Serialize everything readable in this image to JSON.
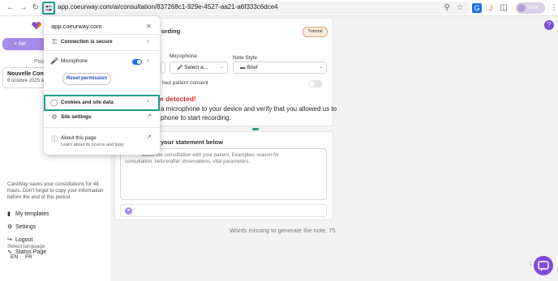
{
  "browser": {
    "url": "app.coeurway.com/ai/consultation/837268c1-929e-4527-aa21-a6f333c6dce4",
    "profile_label": "Work",
    "extensions": [
      "G",
      "J"
    ]
  },
  "site_info": {
    "domain": "app.coeurway.com",
    "connection": "Connection is secure",
    "microphone": "Microphone",
    "microphone_enabled": true,
    "reset_permission": "Reset permission",
    "cookies": "Cookies and site data",
    "site_settings": "Site settings",
    "about_title": "About this page",
    "about_sub": "Learn about its source and topic"
  },
  "sidebar": {
    "new_label": "+ Ne",
    "posts_label": "Post",
    "consultation": {
      "title": "Nouvelle Consult",
      "date": "8 octobre 2025 à 1"
    },
    "retention_notice": "CareWay saves your consultations for 48 hours. Don't forget to copy your information before the end of this period.",
    "nav": [
      {
        "label": "My templates",
        "icon": "templates-icon"
      },
      {
        "label": "Settings",
        "icon": "gear-icon"
      },
      {
        "label": "Logout",
        "icon": "logout-icon"
      },
      {
        "label": "Status Page",
        "icon": "status-icon"
      }
    ],
    "language_label": "Select language",
    "languages": [
      "EN",
      "FR"
    ]
  },
  "recording": {
    "heading": "ording",
    "tutorial": "Tutorial",
    "microphone_label": "Microphone",
    "microphone_value": "Select a...",
    "note_style_label": "Note Style",
    "note_style_value": "Brief",
    "consent": "hed patient consent",
    "consent_on": false,
    "alert": "e detected!",
    "instruction_line1": "a microphone to your device and verify that you allowed us to",
    "instruction_line2": "phone to start recording."
  },
  "statement": {
    "heading": "your statement below",
    "placeholder_line1": "about the consultation with your patient. Examples: reason for",
    "placeholder_line2": "consultation, before/after observations, vital parameters.",
    "words_missing": "Words missing to generate the note: 75"
  }
}
